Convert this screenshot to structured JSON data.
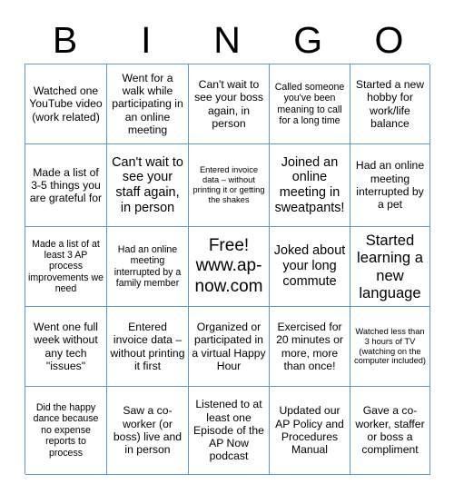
{
  "header": {
    "letters": [
      "B",
      "I",
      "N",
      "G",
      "O"
    ]
  },
  "colors": {
    "grid_border": "#5b9bd5",
    "text": "#000000",
    "background": "#ffffff"
  },
  "grid": {
    "rows": [
      [
        {
          "text": "Watched one YouTube video (work related)",
          "size": "sz-m"
        },
        {
          "text": "Went for a walk while participating in an online meeting",
          "size": "sz-m"
        },
        {
          "text": "Can't wait to see your boss again, in person",
          "size": "sz-m"
        },
        {
          "text": "Called someone you've been meaning to call for a long time",
          "size": "sz-s"
        },
        {
          "text": "Started a new hobby for work/life balance",
          "size": "sz-m"
        }
      ],
      [
        {
          "text": "Made a list of 3-5 things you are grateful for",
          "size": "sz-m"
        },
        {
          "text": "Can't wait to see your staff again, in person",
          "size": "sz-l"
        },
        {
          "text": "Entered invoice data – without printing it or getting the shakes",
          "size": "sz-xs"
        },
        {
          "text": "Joined an online meeting in sweatpants!",
          "size": "sz-l"
        },
        {
          "text": "Had an online meeting interrupted by a pet",
          "size": "sz-m"
        }
      ],
      [
        {
          "text": "Made a list of at least 3 AP process improvements we need",
          "size": "sz-s"
        },
        {
          "text": "Had an online meeting interrupted by a family member",
          "size": "sz-s"
        },
        {
          "text": "Free! www.ap-now.com",
          "size": "free-cell"
        },
        {
          "text": "Joked about your long commute",
          "size": "sz-l"
        },
        {
          "text": "Started learning a new language",
          "size": "sz-xl"
        }
      ],
      [
        {
          "text": "Went one full week without any tech \"issues\"",
          "size": "sz-m"
        },
        {
          "text": "Entered invoice data – without printing it first",
          "size": "sz-m"
        },
        {
          "text": "Organized or participated in a virtual Happy Hour",
          "size": "sz-m"
        },
        {
          "text": "Exercised for 20 minutes or more, more than once!",
          "size": "sz-m"
        },
        {
          "text": "Watched less than 3 hours of TV (watching on the computer included)",
          "size": "sz-xs"
        }
      ],
      [
        {
          "text": "Did the happy dance because no expense reports to process",
          "size": "sz-s"
        },
        {
          "text": "Saw a co-worker (or boss) live and in person",
          "size": "sz-m"
        },
        {
          "text": "Listened to at least one Episode of the AP Now podcast",
          "size": "sz-m"
        },
        {
          "text": "Updated our AP Policy and Procedures Manual",
          "size": "sz-m"
        },
        {
          "text": "Gave a co-worker, staffer or boss a compliment",
          "size": "sz-m"
        }
      ]
    ]
  }
}
